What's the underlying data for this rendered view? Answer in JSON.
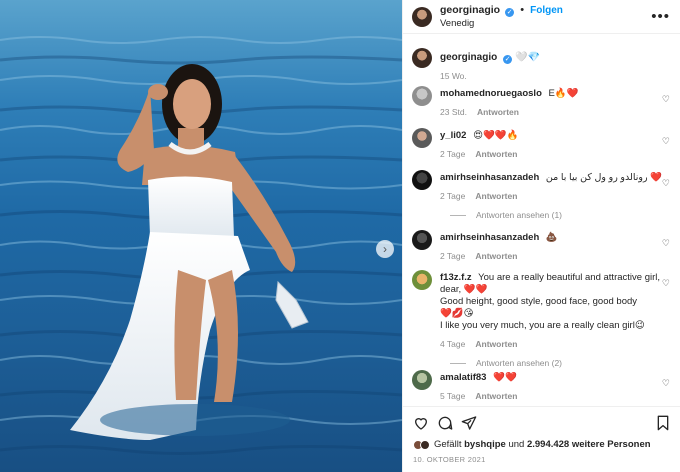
{
  "header": {
    "username": "georginagio",
    "follow_label": "Folgen",
    "location": "Venedig"
  },
  "caption": {
    "username": "georginagio",
    "text": "🤍💎",
    "age": "15 Wo."
  },
  "reply_label": "Antworten",
  "comments": [
    {
      "username": "mohamednoruegaoslo",
      "text": "E🔥❤️",
      "age": "23 Std."
    },
    {
      "username": "y_li02",
      "text": "😍❤️❤️🔥",
      "age": "2 Tage"
    },
    {
      "username": "amirhseinhasanzadeh",
      "text": "رونالدو رو ول کن بیا با من ❤️",
      "age": "2 Tage",
      "replies": "Antworten ansehen (1)"
    },
    {
      "username": "amirhseinhasanzadeh",
      "text": "💩",
      "age": "2 Tage"
    },
    {
      "username": "f13z.f.z",
      "text": "You are a really beautiful and attractive girl, dear, ❤️❤️",
      "text2": "Good height, good style, good face, good body",
      "text3": "❤️💋😘",
      "text4": "I like you very much, you are a really clean girl😉",
      "age": "4 Tage",
      "replies": "Antworten ansehen (2)"
    },
    {
      "username": "amalatif83",
      "text": "❤️❤️",
      "age": "5 Tage"
    }
  ],
  "likes": {
    "liked_by_prefix": "Gefällt ",
    "liked_by_user": "byshqipe",
    "and_label": " und ",
    "count": "2.994.428",
    "others_label": " weitere Personen"
  },
  "date": "10. OKTOBER 2021",
  "icons": {
    "verified": "verified-badge-icon",
    "more": "more-options-icon",
    "like": "heart-icon",
    "comment": "comment-icon",
    "share": "share-icon",
    "save": "bookmark-icon",
    "next": "chevron-right-icon"
  }
}
